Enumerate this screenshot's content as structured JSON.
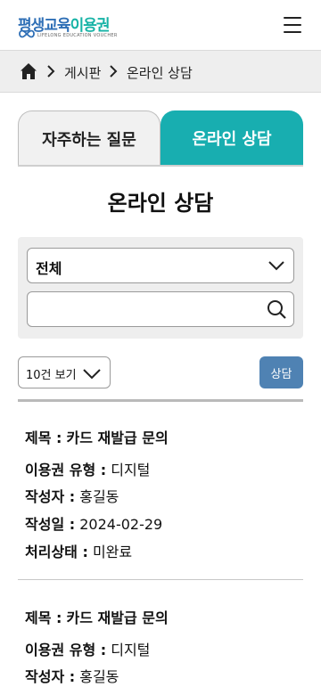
{
  "header": {
    "logo_text_part1": "평생교육",
    "logo_text_part2": "이용권",
    "logo_subtext": "LIFELONG EDUCATION VOUCHER",
    "menu_icon": "hamburger-menu-icon"
  },
  "breadcrumb": {
    "home_icon": "home-icon",
    "items": [
      "게시판",
      "온라인 상담"
    ]
  },
  "tabs": [
    {
      "label": "자주하는 질문",
      "active": false
    },
    {
      "label": "온라인 상담",
      "active": true
    }
  ],
  "page_title": "온라인 상담",
  "search": {
    "category_value": "전체",
    "keyword_value": "",
    "keyword_placeholder": ""
  },
  "controls": {
    "page_size_label": "10건 보기",
    "consult_button_label": "상담"
  },
  "list": {
    "items": [
      {
        "title_label": "제목 :",
        "title": "카드 재발급 문의",
        "type_label": "이용권 유형 :",
        "type": "디지털",
        "author_label": "작성자 :",
        "author": "홍길동",
        "date_label": "작성일 :",
        "date": "2024-02-29",
        "status_label": "처리상태 :",
        "status": "미완료"
      },
      {
        "title_label": "제목 :",
        "title": "카드 재발급 문의",
        "type_label": "이용권 유형 :",
        "type": "디지털",
        "author_label": "작성자 :",
        "author": "홍길동"
      }
    ]
  },
  "colors": {
    "accent_teal": "#18aeb0",
    "button_blue": "#4f82b3",
    "logo_blue": "#2f6fb6",
    "logo_green": "#17b3a6"
  }
}
